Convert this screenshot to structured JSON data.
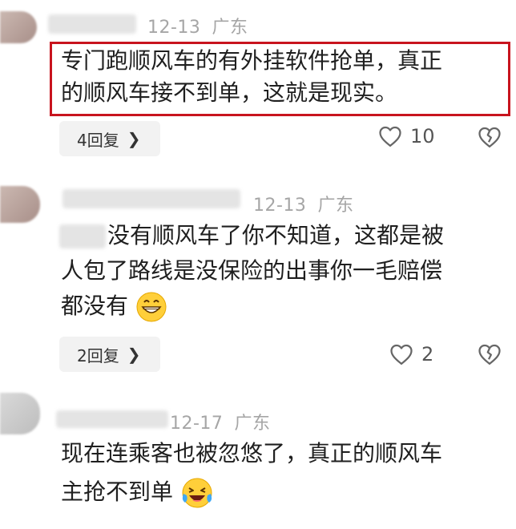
{
  "comments": [
    {
      "date": "12-13",
      "location": "广东",
      "lines": [
        "专门跑顺风车的有外挂软件抢单，真正",
        "的顺风车接不到单，这就是现实。"
      ],
      "replies": "4回复",
      "likes": "10"
    },
    {
      "date": "12-13",
      "location": "广东",
      "lines": [
        "没有顺风车了你不知道，这都是被",
        "人包了路线是没保险的出事你一毛赔偿",
        "都没有"
      ],
      "replies": "2回复",
      "likes": "2"
    },
    {
      "date": "12-17",
      "location": "广东",
      "lines": [
        "现在连乘客也被忽悠了，真正的顺风车",
        "主抢不到单"
      ]
    }
  ],
  "icons": {
    "like": "heart-outline-icon",
    "dislike": "broken-heart-icon",
    "chevron": "chevron-right-icon",
    "grin_emoji": "grinning-emoji-icon",
    "laugh_cry_emoji": "laughing-crying-emoji-icon"
  },
  "colors": {
    "highlight": "#c8141e",
    "meta": "#a6a6a6"
  }
}
